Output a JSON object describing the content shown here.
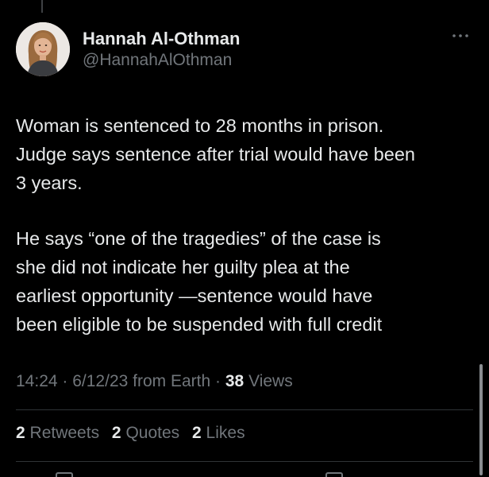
{
  "author": {
    "name": "Hannah Al-Othman",
    "handle": "@HannahAlOthman"
  },
  "tweet": {
    "paragraph1": "Woman is sentenced to 28 months in prison.\nJudge says sentence after trial would have been\n3 years.",
    "paragraph2": "He says “one of the tragedies” of the case is\nshe did not indicate her guilty plea at the\nearliest opportunity —sentence would have\nbeen eligible to be suspended with full credit"
  },
  "meta": {
    "time": "14:24",
    "date": "6/12/23",
    "source": "from Earth",
    "views_count": "38",
    "views_label": "Views"
  },
  "stats": {
    "retweets_count": "2",
    "retweets_label": "Retweets",
    "quotes_count": "2",
    "quotes_label": "Quotes",
    "likes_count": "2",
    "likes_label": "Likes"
  },
  "icons": {
    "more": "more-options-icon",
    "avatar": "avatar"
  },
  "colors": {
    "background": "#000000",
    "text_primary": "#e7e9ea",
    "text_secondary": "#71767b",
    "divider": "#2f3336"
  }
}
